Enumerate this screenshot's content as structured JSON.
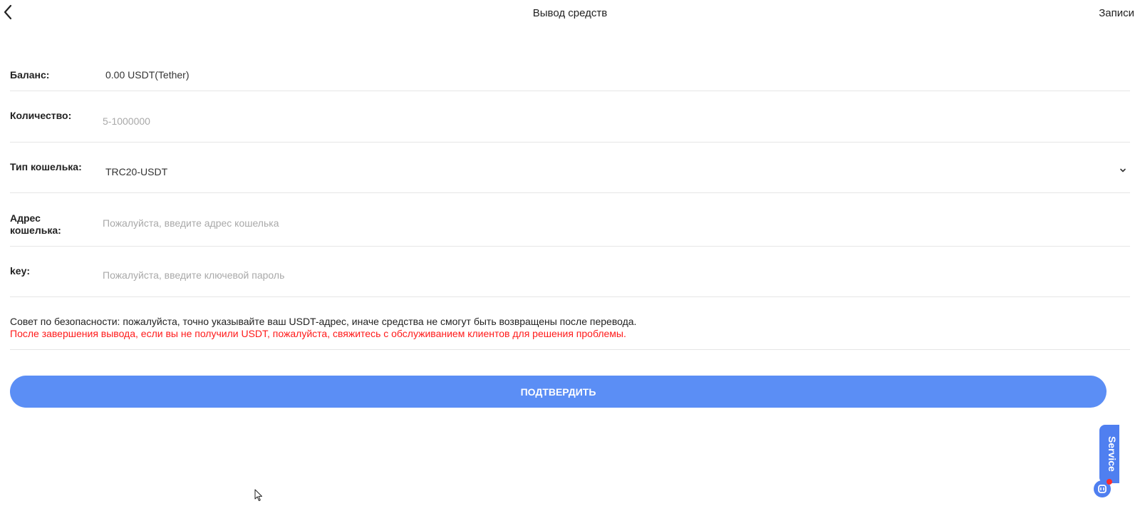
{
  "header": {
    "title": "Вывод средств",
    "records_label": "Записи"
  },
  "form": {
    "balance": {
      "label": "Баланс:",
      "value": "0.00 USDT(Tether)"
    },
    "amount": {
      "label": "Количество:",
      "value": "",
      "placeholder": "5-1000000"
    },
    "wallet_type": {
      "label": "Тип кошелька:",
      "selected": "TRC20-USDT"
    },
    "wallet_address": {
      "label": "Адрес кошелька:",
      "value": "",
      "placeholder": "Пожалуйста, введите адрес кошелька"
    },
    "key": {
      "label": "key:",
      "value": "",
      "placeholder": "Пожалуйста, введите ключевой пароль"
    }
  },
  "notice": {
    "security_tip": "Совет по безопасности: пожалуйста, точно указывайте ваш USDT-адрес, иначе средства не смогут быть возвращены после перевода.",
    "support_tip": "После завершения вывода, если вы не получили USDT, пожалуйста, свяжитесь с обслуживанием клиентов для решения проблемы."
  },
  "confirm_label": "ПОДТВЕРДИТЬ",
  "service": {
    "label": "Service"
  },
  "colors": {
    "accent": "#5b8ef5",
    "warning": "#ff1a1a",
    "service": "#4f7ff0"
  },
  "icons": {
    "back": "chevron-left-icon",
    "dropdown": "chevron-down-icon",
    "service": "chat-icon"
  }
}
